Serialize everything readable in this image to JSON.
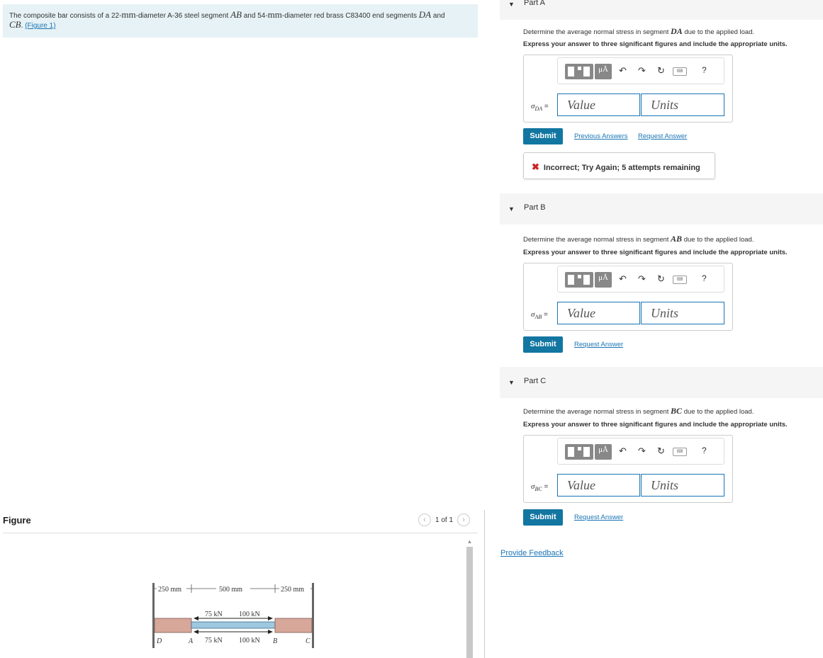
{
  "problem": {
    "t1": "The composite bar consists of a 22-",
    "mm1": "mm",
    "t2": "-diameter A-36 steel segment ",
    "ab": "AB",
    "t3": " and 54-",
    "mm2": "mm",
    "t4": "-diameter red brass C83400 end segments ",
    "da": "DA",
    "t5": " and",
    "cb": "CB",
    "t6": ". ",
    "figure_link": "(Figure 1)"
  },
  "figure_panel": {
    "title": "Figure",
    "pager": "1 of 1",
    "prev_icon": "chevron-left-icon",
    "next_icon": "chevron-right-icon",
    "labels": {
      "dim1": "250 mm",
      "dim2": "500 mm",
      "dim3": "250 mm",
      "f_top1": "75 kN",
      "f_top2": "100 kN",
      "f_bot1": "75 kN",
      "f_bot2": "100 kN",
      "pD": "D",
      "pA": "A",
      "pB": "B",
      "pC": "C"
    },
    "colors": {
      "brass": "#d7a79a",
      "steel": "#9ec8e0"
    }
  },
  "toolbar": {
    "mu_label": "μÅ",
    "undo_icon": "undo-icon",
    "redo_icon": "redo-icon",
    "reset_icon": "reset-icon",
    "keyboard_icon": "keyboard-icon",
    "help_label": "?"
  },
  "partA": {
    "label": "Part A",
    "q_pre": "Determine the average normal stress in segment ",
    "q_var": "DA",
    "q_post": " due to the applied load.",
    "instr": "Express your answer to three significant figures and include the appropriate units.",
    "sym": "σ",
    "sub": "DA",
    "eq": " =",
    "value_placeholder": "Value",
    "units_placeholder": "Units",
    "submit": "Submit",
    "prev_answers": "Previous Answers",
    "request_answer": "Request Answer",
    "feedback": "Incorrect; Try Again; 5 attempts remaining"
  },
  "partB": {
    "label": "Part B",
    "q_pre": "Determine the average normal stress in segment ",
    "q_var": "AB",
    "q_post": " due to the applied load.",
    "instr": "Express your answer to three significant figures and include the appropriate units.",
    "sym": "σ",
    "sub": "AB",
    "eq": " =",
    "value_placeholder": "Value",
    "units_placeholder": "Units",
    "submit": "Submit",
    "request_answer": "Request Answer"
  },
  "partC": {
    "label": "Part C",
    "q_pre": "Determine the average normal stress in segment ",
    "q_var": "BC",
    "q_post": " due to the applied load.",
    "instr": "Express your answer to three significant figures and include the appropriate units.",
    "sym": "σ",
    "sub": "BC",
    "eq": " =",
    "value_placeholder": "Value",
    "units_placeholder": "Units",
    "submit": "Submit",
    "request_answer": "Request Answer"
  },
  "footer": {
    "provide_feedback": "Provide Feedback"
  }
}
